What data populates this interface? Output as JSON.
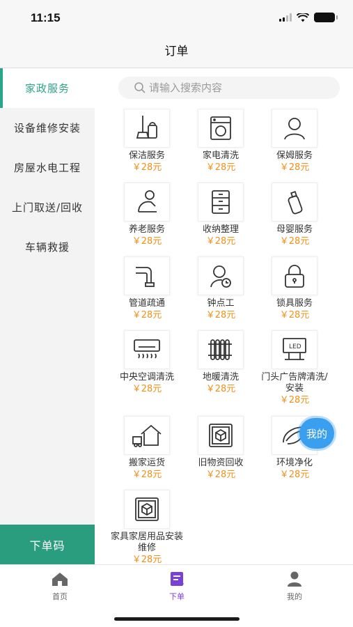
{
  "status": {
    "time": "11:15"
  },
  "nav": {
    "title": "订单"
  },
  "colors": {
    "accent": "#2ba58a",
    "price": "#f39019",
    "tab_active": "#7a3fd6",
    "bubble": "#3b9ff0"
  },
  "sidebar": {
    "items": [
      {
        "label": "家政服务",
        "active": true
      },
      {
        "label": "设备维修安装"
      },
      {
        "label": "房屋水电工程"
      },
      {
        "label": "上门取送/回收"
      },
      {
        "label": "车辆救援"
      }
    ],
    "order_code_label": "下单码"
  },
  "search": {
    "placeholder": "请输入搜索内容"
  },
  "services": [
    {
      "name": "保洁服务",
      "price": "￥28元",
      "icon": "cleaning-icon"
    },
    {
      "name": "家电清洗",
      "price": "￥28元",
      "icon": "washing-machine-icon"
    },
    {
      "name": "保姆服务",
      "price": "￥28元",
      "icon": "person-icon"
    },
    {
      "name": "养老服务",
      "price": "￥28元",
      "icon": "elderly-care-icon"
    },
    {
      "name": "收纳整理",
      "price": "￥28元",
      "icon": "drawer-cabinet-icon"
    },
    {
      "name": "母婴服务",
      "price": "￥28元",
      "icon": "baby-bottle-icon"
    },
    {
      "name": "管道疏通",
      "price": "￥28元",
      "icon": "pipe-icon"
    },
    {
      "name": "钟点工",
      "price": "￥28元",
      "icon": "clock-worker-icon"
    },
    {
      "name": "锁具服务",
      "price": "￥28元",
      "icon": "lock-icon"
    },
    {
      "name": "中央空调清洗",
      "price": "￥28元",
      "icon": "air-conditioner-icon"
    },
    {
      "name": "地暖清洗",
      "price": "￥28元",
      "icon": "radiator-icon"
    },
    {
      "name": "门头广告牌清洗/安装",
      "price": "￥28元",
      "icon": "led-sign-icon"
    },
    {
      "name": "搬家运货",
      "price": "￥28元",
      "icon": "moving-truck-icon"
    },
    {
      "name": "旧物资回收",
      "price": "￥28元",
      "icon": "recycle-box-icon"
    },
    {
      "name": "环境净化",
      "price": "￥28元",
      "icon": "environment-icon"
    },
    {
      "name": "家具家居用品安装维修",
      "price": "￥28元",
      "icon": "furniture-box-icon"
    }
  ],
  "floating": {
    "label": "我的"
  },
  "tabbar": {
    "items": [
      {
        "label": "首页",
        "icon": "home-icon"
      },
      {
        "label": "下单",
        "icon": "order-icon",
        "active": true
      },
      {
        "label": "我的",
        "icon": "user-icon"
      }
    ]
  }
}
